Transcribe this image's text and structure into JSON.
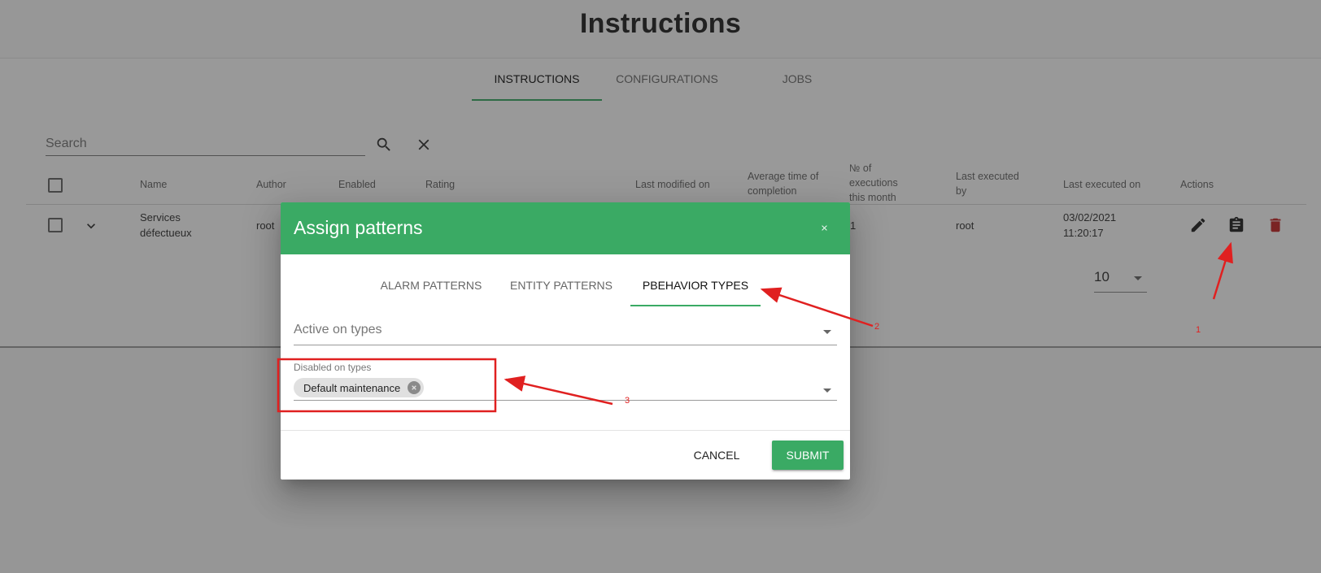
{
  "page": {
    "title": "Instructions",
    "tabs": [
      {
        "label": "INSTRUCTIONS",
        "active": true
      },
      {
        "label": "CONFIGURATIONS",
        "active": false
      },
      {
        "label": "JOBS",
        "active": false
      }
    ]
  },
  "search": {
    "placeholder": "Search",
    "value": "",
    "search_icon": "search-icon",
    "clear_icon": "close-icon"
  },
  "table": {
    "columns": [
      "Name",
      "Author",
      "Enabled",
      "Rating",
      "Last modified on",
      "Average time of completion",
      "№ of executions this month",
      "Last executed by",
      "Last executed on",
      "Actions"
    ],
    "rows": [
      {
        "name": "Services défectueux",
        "author": "root",
        "executions_this_month": "1",
        "last_executed_by": "root",
        "last_executed_on_date": "03/02/2021",
        "last_executed_on_time": "11:20:17",
        "actions": [
          "edit-icon",
          "assign-patterns-icon",
          "delete-icon"
        ]
      }
    ],
    "rows_per_page": "10"
  },
  "dialog": {
    "title": "Assign patterns",
    "close_icon": "close-icon",
    "tabs": [
      {
        "label": "ALARM PATTERNS",
        "active": false
      },
      {
        "label": "ENTITY PATTERNS",
        "active": false
      },
      {
        "label": "PBEHAVIOR TYPES",
        "active": true
      }
    ],
    "active_on_types": {
      "placeholder": "Active on types",
      "values": []
    },
    "disabled_on_types": {
      "label": "Disabled on types",
      "values": [
        "Default maintenance"
      ]
    },
    "cancel_label": "CANCEL",
    "submit_label": "SUBMIT"
  },
  "annotations": {
    "color": "#e02020",
    "labels": [
      "1",
      "2",
      "3"
    ]
  },
  "colors": {
    "accent": "#3aaa64",
    "delete": "#c62828",
    "annotation": "#e02020"
  }
}
